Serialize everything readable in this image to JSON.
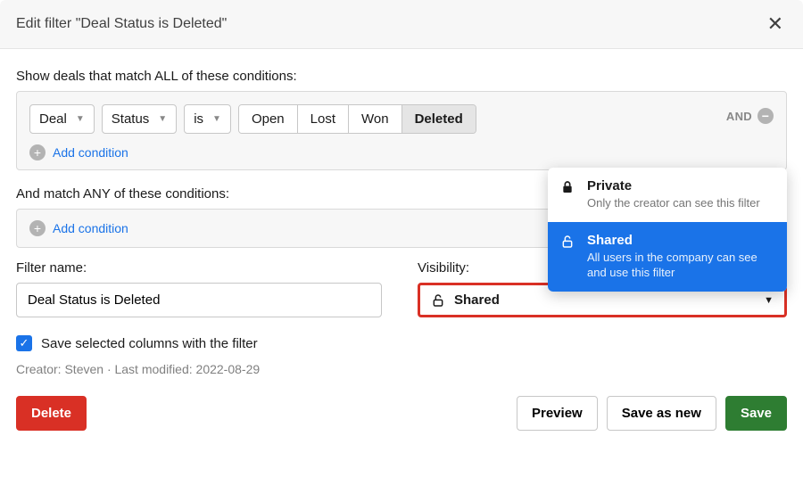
{
  "header": {
    "title": "Edit filter \"Deal Status is Deleted\""
  },
  "sections": {
    "all_label": "Show deals that match ALL of these conditions:",
    "any_label": "And match ANY of these conditions:"
  },
  "condition": {
    "field": "Deal",
    "attribute": "Status",
    "operator": "is",
    "options": [
      "Open",
      "Lost",
      "Won",
      "Deleted"
    ],
    "selected": "Deleted",
    "join": "AND"
  },
  "add_condition_label": "Add condition",
  "filter_name": {
    "label": "Filter name:",
    "value": "Deal Status is Deleted"
  },
  "visibility": {
    "label": "Visibility:",
    "selected": "Shared",
    "options": [
      {
        "key": "private",
        "title": "Private",
        "desc": "Only the creator can see this filter"
      },
      {
        "key": "shared",
        "title": "Shared",
        "desc": "All users in the company can see and use this filter"
      }
    ]
  },
  "save_columns": {
    "label": "Save selected columns with the filter",
    "checked": true
  },
  "meta": "Creator: Steven · Last modified: 2022-08-29",
  "footer": {
    "delete": "Delete",
    "preview": "Preview",
    "save_as_new": "Save as new",
    "save": "Save"
  }
}
